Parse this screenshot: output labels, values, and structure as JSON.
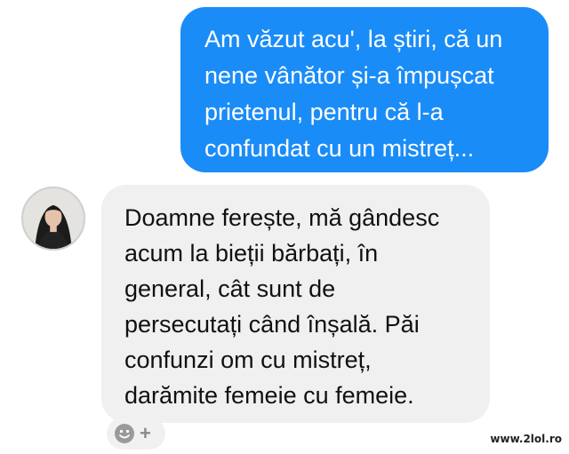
{
  "messages": {
    "outgoing": {
      "text": "Am văzut acu', la știri, că un\nnene vânător și-a împușcat\nprietenul, pentru că l-a\nconfundat cu un mistreț...",
      "color": "#1a8cf7"
    },
    "incoming": {
      "text": "Doamne ferește, mă gândesc\nacum la bieții bărbați, în\ngeneral, cât sunt de\npersecutați când înșală. Păi\nconfunzi om cu mistreț,\ndarămite femeie cu femeie.",
      "avatar": "avatar-photo"
    }
  },
  "reaction": {
    "icon": "smile-icon",
    "plus": "+"
  },
  "watermark": "www.2lol.ro"
}
